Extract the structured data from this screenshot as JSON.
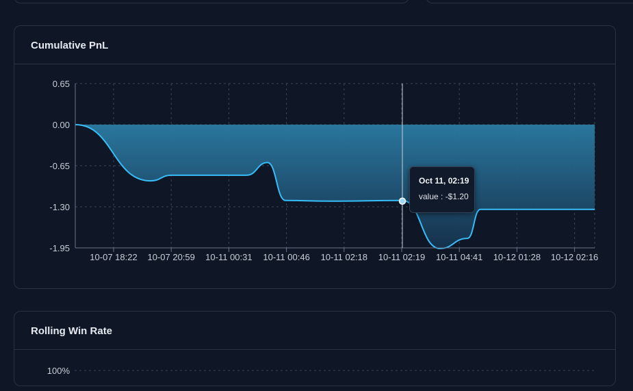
{
  "colors": {
    "background": "#0f1727",
    "panel_border": "#273244",
    "line": "#38bdf8",
    "area_top": "#2b7ba3",
    "area_bottom": "#1a3a55",
    "grid": "#3a4558"
  },
  "pnl_panel": {
    "title": "Cumulative PnL"
  },
  "winrate_panel": {
    "title": "Rolling Win Rate",
    "first_tick": "100%"
  },
  "tooltip": {
    "title": "Oct 11, 02:19",
    "value": "value : -$1.20"
  },
  "chart_data": {
    "type": "area",
    "title": "Cumulative PnL",
    "categories": [
      "10-07 18:22",
      "10-07 20:59",
      "10-11 00:31",
      "10-11 00:46",
      "10-11 02:18",
      "10-11 02:19",
      "10-11 04:41",
      "10-12 01:28",
      "10-12 02:16"
    ],
    "y_ticks": [
      "0.65",
      "0.00",
      "-0.65",
      "-1.30",
      "-1.95"
    ],
    "ylim": [
      -1.95,
      0.65
    ],
    "grid": true,
    "series": [
      {
        "values": [
          0.0,
          -0.89,
          -0.8,
          -0.8,
          -0.6,
          -1.2,
          -1.21,
          -1.2,
          -1.96,
          -1.8,
          -1.34,
          -1.34,
          -1.34
        ]
      }
    ],
    "highlight": {
      "category": "10-11 02:19",
      "value": -1.2
    }
  }
}
